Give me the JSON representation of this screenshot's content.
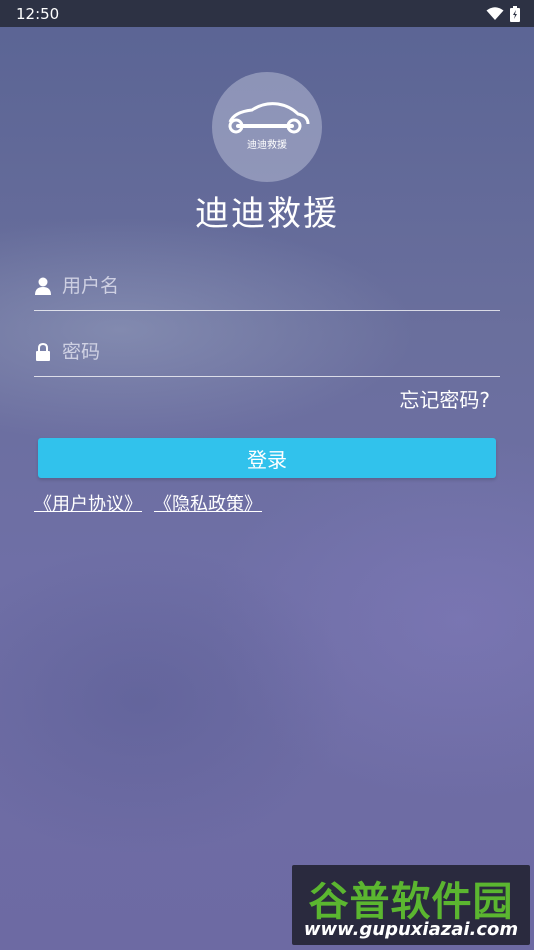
{
  "status_bar": {
    "time": "12:50",
    "icons": [
      "wifi-icon",
      "battery-icon"
    ]
  },
  "logo": {
    "text": "迪迪救援",
    "icon": "car-wrench-icon"
  },
  "app_title": "迪迪救援",
  "username": {
    "placeholder": "用户名",
    "value": "",
    "icon": "user-icon"
  },
  "password": {
    "placeholder": "密码",
    "value": "",
    "icon": "lock-icon"
  },
  "forgot_password": "忘记密码?",
  "login_button": "登录",
  "links": {
    "user_agreement": "《用户协议》",
    "privacy_policy": "《隐私政策》"
  },
  "watermark": {
    "title": "谷普软件园",
    "url": "www.gupuxiazai.com"
  },
  "colors": {
    "accent": "#31c2ec",
    "status_bar": "#2d3244",
    "watermark_green": "#5bb630"
  }
}
